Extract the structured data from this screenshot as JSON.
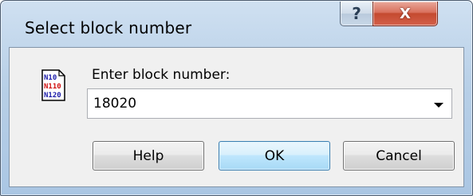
{
  "window": {
    "title": "Select block number"
  },
  "caption_buttons": {
    "help_glyph": "?",
    "close_glyph": "X"
  },
  "icon": {
    "name": "block-number-document-icon",
    "lines": [
      "N10",
      "N110",
      "N120"
    ],
    "line_colors": [
      "#1a1aa8",
      "#d01010",
      "#1a1aa8"
    ]
  },
  "dialog": {
    "prompt": "Enter block number:",
    "combo_value": "18020"
  },
  "buttons": {
    "help": "Help",
    "ok": "OK",
    "cancel": "Cancel"
  }
}
